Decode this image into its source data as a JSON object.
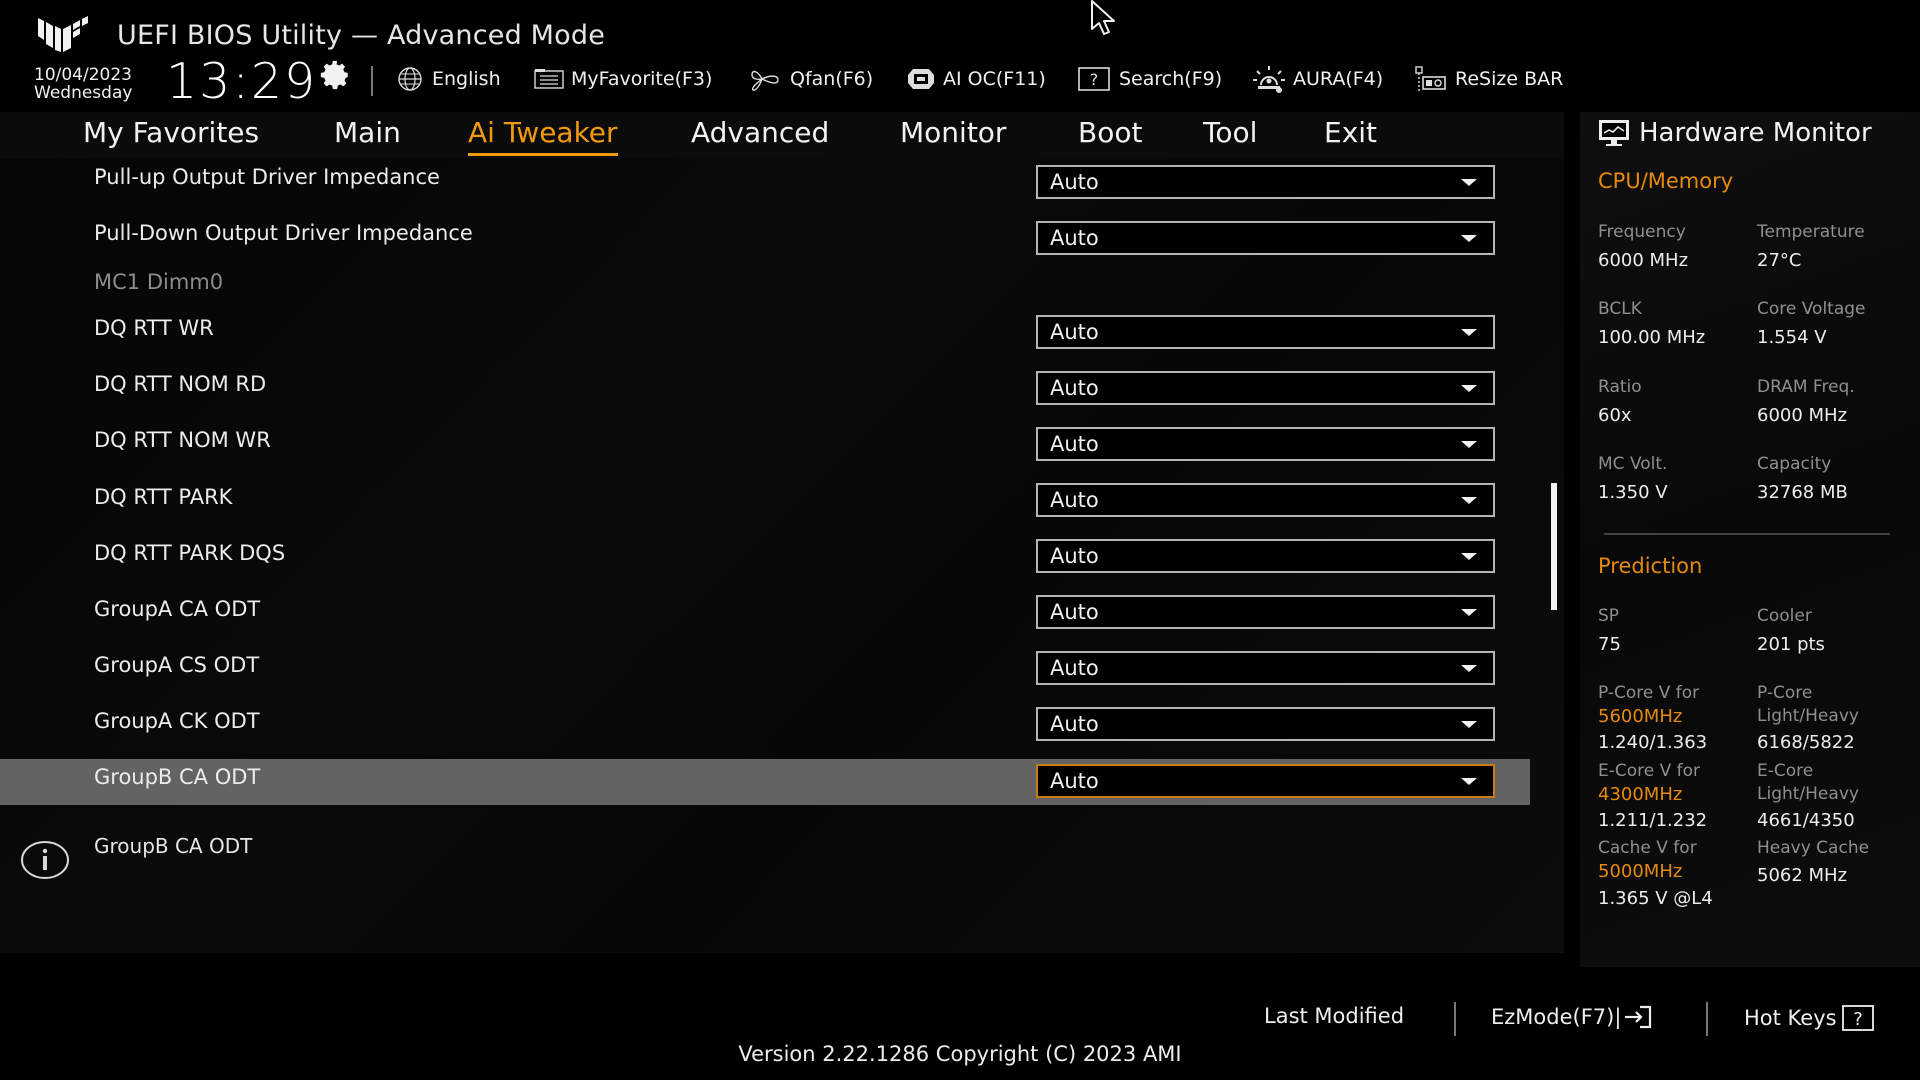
{
  "header": {
    "title": "UEFI BIOS Utility — Advanced Mode",
    "date": "10/04/2023",
    "weekday": "Wednesday",
    "time": "13:29",
    "toolbar": [
      {
        "icon": "globe-icon",
        "label": "English"
      },
      {
        "icon": "favorite-icon",
        "label": "MyFavorite(F3)"
      },
      {
        "icon": "fan-icon",
        "label": "Qfan(F6)"
      },
      {
        "icon": "ai-oc-icon",
        "label": "AI OC(F11)"
      },
      {
        "icon": "search-help-icon",
        "label": "Search(F9)"
      },
      {
        "icon": "aura-icon",
        "label": "AURA(F4)"
      },
      {
        "icon": "resize-bar-icon",
        "label": "ReSize BAR"
      }
    ]
  },
  "tabs": [
    {
      "label": "My Favorites",
      "active": false
    },
    {
      "label": "Main",
      "active": false
    },
    {
      "label": "Ai Tweaker",
      "active": true
    },
    {
      "label": "Advanced",
      "active": false
    },
    {
      "label": "Monitor",
      "active": false
    },
    {
      "label": "Boot",
      "active": false
    },
    {
      "label": "Tool",
      "active": false
    },
    {
      "label": "Exit",
      "active": false
    }
  ],
  "settings": [
    {
      "label": "Pull-up Output Driver Impedance",
      "value": "Auto"
    },
    {
      "label": "Pull-Down Output Driver Impedance",
      "value": "Auto"
    },
    {
      "label": "MC1 Dimm0",
      "section": true
    },
    {
      "label": "DQ RTT WR",
      "value": "Auto"
    },
    {
      "label": "DQ RTT NOM RD",
      "value": "Auto"
    },
    {
      "label": "DQ RTT NOM WR",
      "value": "Auto"
    },
    {
      "label": "DQ RTT PARK",
      "value": "Auto"
    },
    {
      "label": "DQ RTT PARK DQS",
      "value": "Auto"
    },
    {
      "label": "GroupA CA ODT",
      "value": "Auto"
    },
    {
      "label": "GroupA CS ODT",
      "value": "Auto"
    },
    {
      "label": "GroupA CK ODT",
      "value": "Auto"
    },
    {
      "label": "GroupB CA ODT",
      "value": "Auto",
      "selected": true
    }
  ],
  "info": {
    "text": "GroupB CA ODT"
  },
  "hardware_monitor": {
    "title": "Hardware Monitor",
    "cpu_memory": {
      "title": "CPU/Memory",
      "items": [
        {
          "label": "Frequency",
          "value": "6000 MHz"
        },
        {
          "label": "Temperature",
          "value": "27°C"
        },
        {
          "label": "BCLK",
          "value": "100.00 MHz"
        },
        {
          "label": "Core Voltage",
          "value": "1.554 V"
        },
        {
          "label": "Ratio",
          "value": "60x"
        },
        {
          "label": "DRAM Freq.",
          "value": "6000 MHz"
        },
        {
          "label": "MC Volt.",
          "value": "1.350 V"
        },
        {
          "label": "Capacity",
          "value": "32768 MB"
        }
      ]
    },
    "prediction": {
      "title": "Prediction",
      "sp_label": "SP",
      "sp_value": "75",
      "cooler_label": "Cooler",
      "cooler_value": "201 pts",
      "pcore_v_label": "P-Core V for",
      "pcore_v_freq": "5600MHz",
      "pcore_v_value": "1.240/1.363",
      "pcore_lh_label1": "P-Core",
      "pcore_lh_label2": "Light/Heavy",
      "pcore_lh_value": "6168/5822",
      "ecore_v_label": "E-Core V for",
      "ecore_v_freq": "4300MHz",
      "ecore_v_value": "1.211/1.232",
      "ecore_lh_label1": "E-Core",
      "ecore_lh_label2": "Light/Heavy",
      "ecore_lh_value": "4661/4350",
      "cache_v_label": "Cache V for",
      "cache_v_freq": "5000MHz",
      "cache_v_value": "1.365 V @L4",
      "heavy_cache_label": "Heavy Cache",
      "heavy_cache_value": "5062 MHz"
    }
  },
  "footer": {
    "last_modified": "Last Modified",
    "ezmode": "EzMode(F7)|",
    "hotkeys": "Hot Keys",
    "version": "Version 2.22.1286 Copyright (C) 2023 AMI"
  },
  "colors": {
    "accent": "#f29a0e",
    "section_orange": "#e68a0c",
    "selected_row": "#636363",
    "selected_dropdown_border": "#c77d12"
  }
}
